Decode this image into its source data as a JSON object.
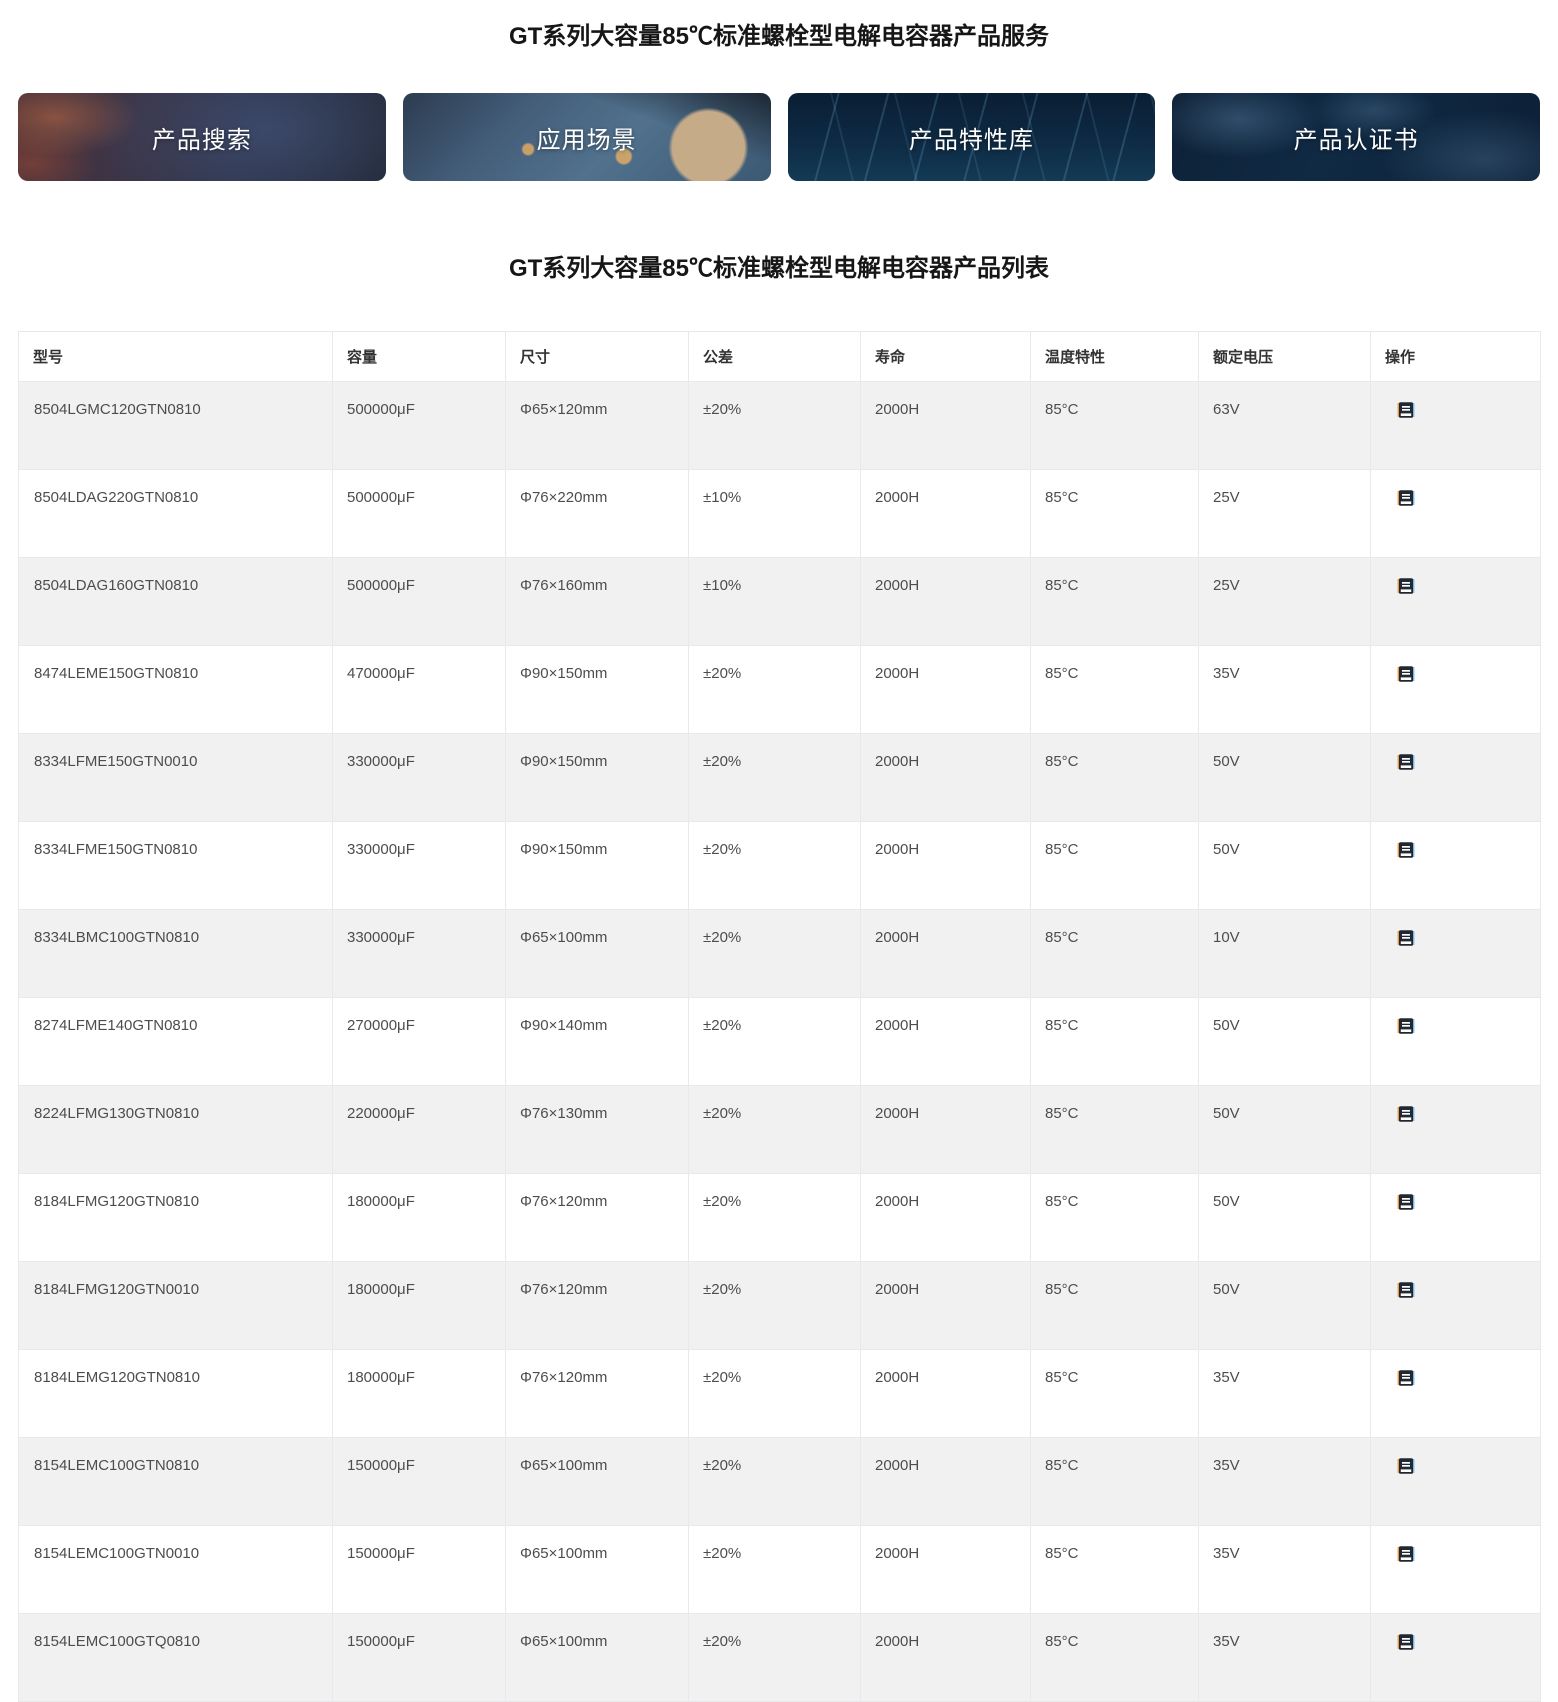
{
  "page": {
    "service_title": "GT系列大容量85℃标准螺栓型电解电容器产品服务",
    "list_title": "GT系列大容量85℃标准螺栓型电解电容器产品列表"
  },
  "nav": {
    "cards": [
      {
        "label": "产品搜索"
      },
      {
        "label": "应用场景"
      },
      {
        "label": "产品特性库"
      },
      {
        "label": "产品认证书"
      }
    ]
  },
  "table": {
    "headers": [
      "型号",
      "容量",
      "尺寸",
      "公差",
      "寿命",
      "温度特性",
      "额定电压",
      "操作"
    ],
    "action_icon": "notebook-icon",
    "rows": [
      {
        "model": "8504LGMC120GTN0810",
        "capacity": "500000μF",
        "size": "Φ65×120mm",
        "tolerance": "±20%",
        "life": "2000H",
        "temp": "85°C",
        "voltage": "63V"
      },
      {
        "model": "8504LDAG220GTN0810",
        "capacity": "500000μF",
        "size": "Φ76×220mm",
        "tolerance": "±10%",
        "life": "2000H",
        "temp": "85°C",
        "voltage": "25V"
      },
      {
        "model": "8504LDAG160GTN0810",
        "capacity": "500000μF",
        "size": "Φ76×160mm",
        "tolerance": "±10%",
        "life": "2000H",
        "temp": "85°C",
        "voltage": "25V"
      },
      {
        "model": "8474LEME150GTN0810",
        "capacity": "470000μF",
        "size": "Φ90×150mm",
        "tolerance": "±20%",
        "life": "2000H",
        "temp": "85°C",
        "voltage": "35V"
      },
      {
        "model": "8334LFME150GTN0010",
        "capacity": "330000μF",
        "size": "Φ90×150mm",
        "tolerance": "±20%",
        "life": "2000H",
        "temp": "85°C",
        "voltage": "50V"
      },
      {
        "model": "8334LFME150GTN0810",
        "capacity": "330000μF",
        "size": "Φ90×150mm",
        "tolerance": "±20%",
        "life": "2000H",
        "temp": "85°C",
        "voltage": "50V"
      },
      {
        "model": "8334LBMC100GTN0810",
        "capacity": "330000μF",
        "size": "Φ65×100mm",
        "tolerance": "±20%",
        "life": "2000H",
        "temp": "85°C",
        "voltage": "10V"
      },
      {
        "model": "8274LFME140GTN0810",
        "capacity": "270000μF",
        "size": "Φ90×140mm",
        "tolerance": "±20%",
        "life": "2000H",
        "temp": "85°C",
        "voltage": "50V"
      },
      {
        "model": "8224LFMG130GTN0810",
        "capacity": "220000μF",
        "size": "Φ76×130mm",
        "tolerance": "±20%",
        "life": "2000H",
        "temp": "85°C",
        "voltage": "50V"
      },
      {
        "model": "8184LFMG120GTN0810",
        "capacity": "180000μF",
        "size": "Φ76×120mm",
        "tolerance": "±20%",
        "life": "2000H",
        "temp": "85°C",
        "voltage": "50V"
      },
      {
        "model": "8184LFMG120GTN0010",
        "capacity": "180000μF",
        "size": "Φ76×120mm",
        "tolerance": "±20%",
        "life": "2000H",
        "temp": "85°C",
        "voltage": "50V"
      },
      {
        "model": "8184LEMG120GTN0810",
        "capacity": "180000μF",
        "size": "Φ76×120mm",
        "tolerance": "±20%",
        "life": "2000H",
        "temp": "85°C",
        "voltage": "35V"
      },
      {
        "model": "8154LEMC100GTN0810",
        "capacity": "150000μF",
        "size": "Φ65×100mm",
        "tolerance": "±20%",
        "life": "2000H",
        "temp": "85°C",
        "voltage": "35V"
      },
      {
        "model": "8154LEMC100GTN0010",
        "capacity": "150000μF",
        "size": "Φ65×100mm",
        "tolerance": "±20%",
        "life": "2000H",
        "temp": "85°C",
        "voltage": "35V"
      },
      {
        "model": "8154LEMC100GTQ0810",
        "capacity": "150000μF",
        "size": "Φ65×100mm",
        "tolerance": "±20%",
        "life": "2000H",
        "temp": "85°C",
        "voltage": "35V"
      }
    ]
  },
  "colors": {
    "row_alt": "#f1f1f2",
    "border": "#e9e9ec",
    "cell_text": "#4d4d4d",
    "heading_text": "#161616",
    "card_text": "#ffffff"
  }
}
